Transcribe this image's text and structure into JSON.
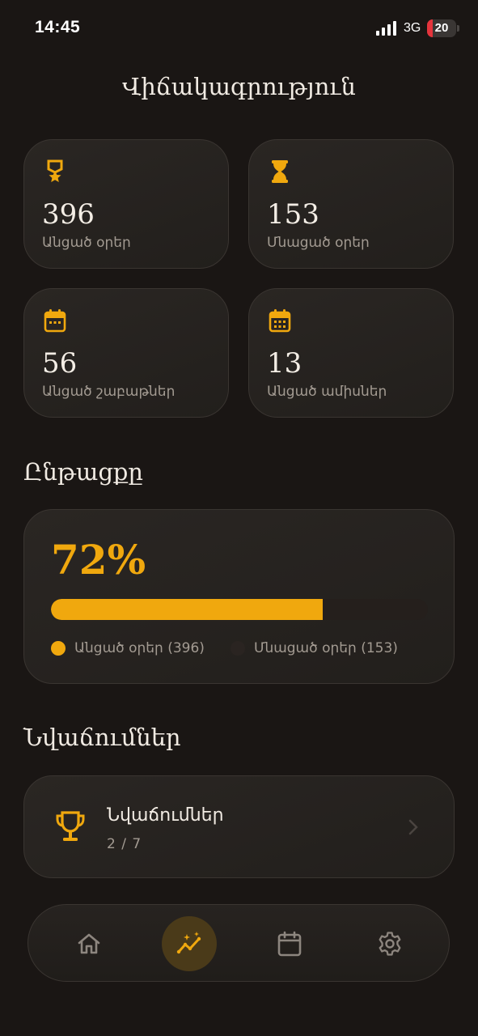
{
  "status": {
    "time": "14:45",
    "network": "3G",
    "battery": "20",
    "battery_level": 0.2
  },
  "title": "Վիճակագրություն",
  "colors": {
    "accent": "#f0a80e",
    "background": "#1a1614",
    "card": "#26221f",
    "muted_text": "#a39b92"
  },
  "stats": [
    {
      "icon": "medal-icon",
      "value": "396",
      "label": "Անցած օրեր"
    },
    {
      "icon": "hourglass-icon",
      "value": "153",
      "label": "Մնացած օրեր"
    },
    {
      "icon": "calendar-week-icon",
      "value": "56",
      "label": "Անցած շաբաթներ"
    },
    {
      "icon": "calendar-month-icon",
      "value": "13",
      "label": "Անցած ամիսներ"
    }
  ],
  "progress": {
    "section_title": "Ընթացքը",
    "percent_label": "72%",
    "percent": 72,
    "legend": [
      {
        "label": "Անցած օրեր (396)",
        "color": "#f0a80e"
      },
      {
        "label": "Մնացած օրեր (153)",
        "color": "#2a2421"
      }
    ]
  },
  "achievements": {
    "section_title": "Նվաճումներ",
    "item_title": "Նվաճումներ",
    "item_count": "2 / 7",
    "icon": "trophy-icon"
  },
  "nav": [
    {
      "icon": "home-icon",
      "active": false
    },
    {
      "icon": "stats-icon",
      "active": true
    },
    {
      "icon": "calendar-icon",
      "active": false
    },
    {
      "icon": "settings-icon",
      "active": false
    }
  ]
}
